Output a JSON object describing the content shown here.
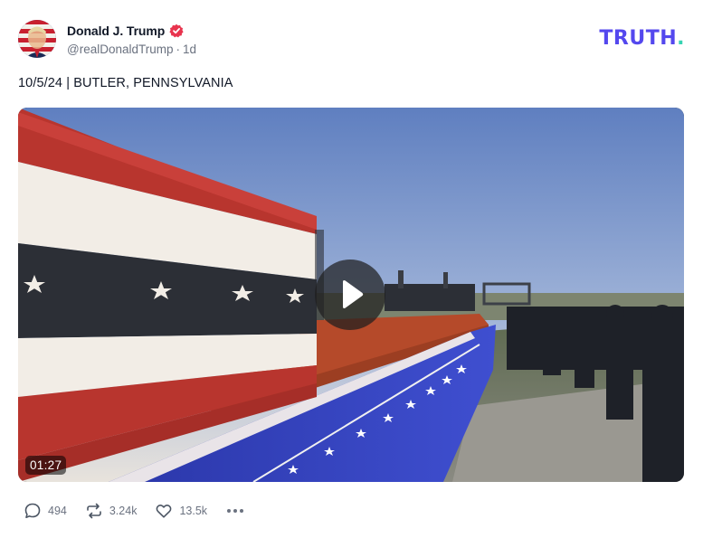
{
  "post": {
    "author_name": "Donald J. Trump",
    "handle": "@realDonaldTrump",
    "separator": "·",
    "time_ago": "1d",
    "text": "10/5/24 | BUTLER, PENNSYLVANIA"
  },
  "brand": {
    "logo_text": "TRUTH",
    "logo_dot": ".",
    "primary_color": "#5448ee",
    "dot_color": "#37d4b3"
  },
  "video": {
    "duration": "01:27",
    "play_icon": "play-icon"
  },
  "actions": {
    "replies": "494",
    "retruths": "3.24k",
    "likes": "13.5k"
  },
  "colors": {
    "verified": "#e8344e",
    "muted_text": "#6b7280"
  }
}
